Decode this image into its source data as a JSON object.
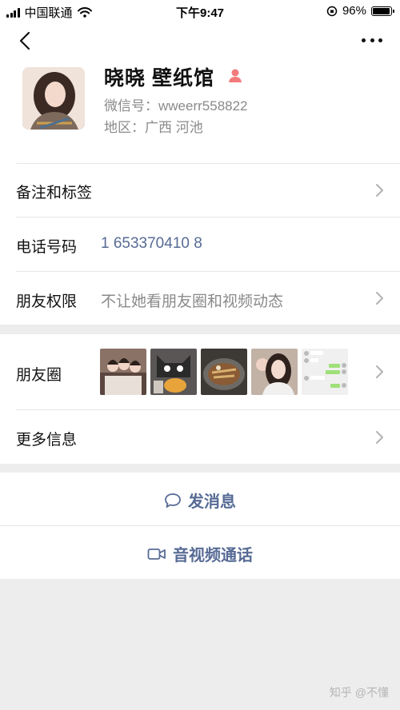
{
  "status_bar": {
    "carrier": "中国联通",
    "time": "下午9:47",
    "battery_percent": "96%",
    "battery_level": 0.96
  },
  "profile": {
    "name": "晓晓  壁纸馆",
    "wechat_id": "微信号：wweerr558822",
    "region": "地区：广西  河池"
  },
  "rows": {
    "remark_label": "备注和标签",
    "phone_label": "电话号码",
    "phone_value": "1 653370410 8",
    "permission_label": "朋友权限",
    "permission_value": "不让她看朋友圈和视频动态",
    "moments_label": "朋友圈",
    "more_info_label": "更多信息"
  },
  "actions": {
    "message": "发消息",
    "call": "音视频通话"
  },
  "icons": {
    "back": "back-arrow-icon",
    "more": "more-dots-icon",
    "gender": "female-icon",
    "chevron": "chevron-right-icon",
    "message": "chat-bubble-icon",
    "call": "video-camera-icon"
  },
  "colors": {
    "link": "#576b95",
    "gender": "#f37b7b",
    "muted": "#8a8a8a"
  },
  "watermark": "知乎 @不懂"
}
